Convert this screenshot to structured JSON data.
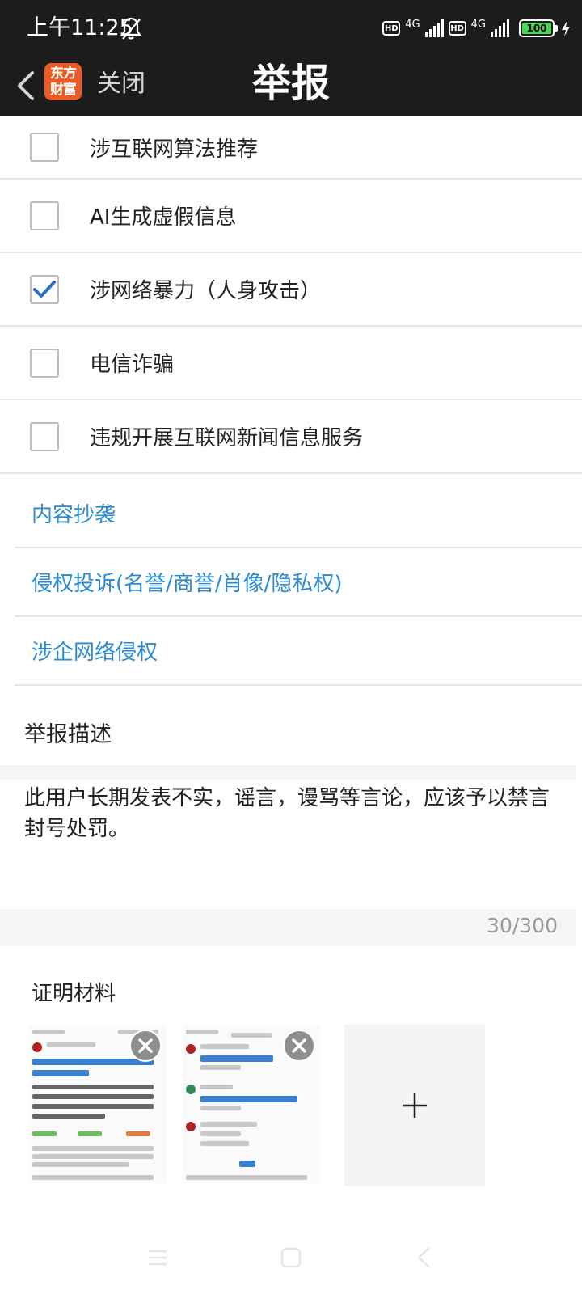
{
  "status_bar": {
    "time": "上午11:25",
    "hd_1": "HD",
    "network_1": "4G",
    "hd_2": "HD",
    "network_2": "4G",
    "battery": "100"
  },
  "nav": {
    "logo_text_line1": "东方",
    "logo_text_line2": "财富",
    "close_label": "关闭",
    "title": "举报"
  },
  "options": [
    {
      "label": "涉互联网算法推荐",
      "checked": false
    },
    {
      "label": "AI生成虚假信息",
      "checked": false
    },
    {
      "label": "涉网络暴力（人身攻击）",
      "checked": true
    },
    {
      "label": "电信诈骗",
      "checked": false
    },
    {
      "label": "违规开展互联网新闻信息服务",
      "checked": false
    }
  ],
  "links": [
    {
      "label": "内容抄袭"
    },
    {
      "label": "侵权投诉(名誉/商誉/肖像/隐私权)"
    },
    {
      "label": "涉企网络侵权"
    }
  ],
  "description": {
    "title": "举报描述",
    "text": "此用户长期发表不实，谣言，谩骂等言论，应该予以禁言封号处罚。",
    "counter": "30/300"
  },
  "evidence": {
    "title": "证明材料"
  },
  "colors": {
    "header_bg": "#1c1c1c",
    "link_blue": "#2a8bd2",
    "check_blue": "#2a6fc9",
    "logo_orange": "#ee5a24",
    "battery_green": "#4cd45a"
  }
}
